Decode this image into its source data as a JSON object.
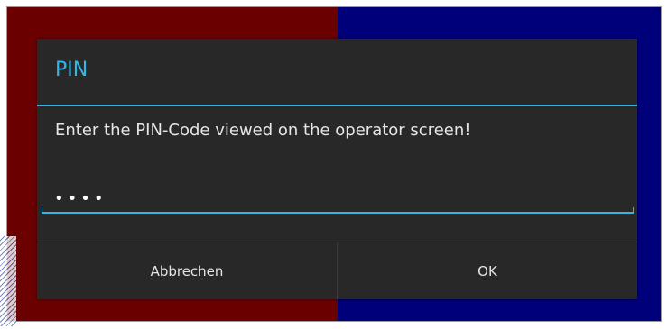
{
  "dialog": {
    "title": "PIN",
    "message": "Enter the PIN-Code viewed on the operator screen!",
    "pin_value": "••••",
    "buttons": {
      "cancel_label": "Abbrechen",
      "ok_label": "OK"
    }
  },
  "colors": {
    "accent": "#33b5e5",
    "dialog_bg": "#282828",
    "bg_left": "#6b0000",
    "bg_right": "#00007a"
  }
}
